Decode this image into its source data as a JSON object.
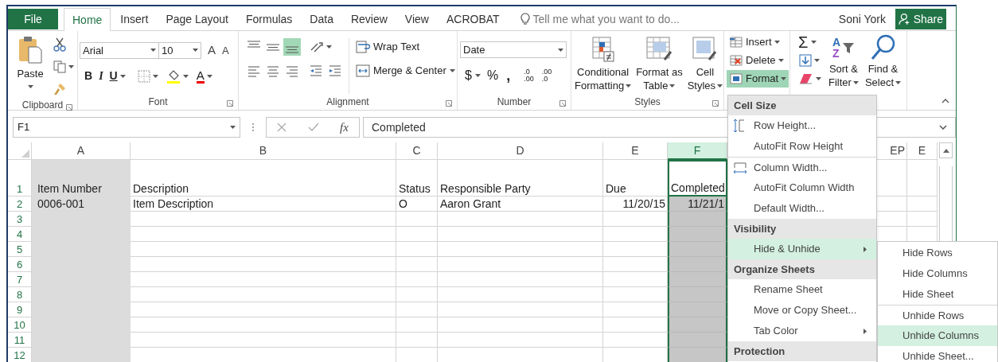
{
  "tabs": [
    {
      "label": "File",
      "kind": "file",
      "selected": false
    },
    {
      "label": "Home",
      "kind": "tab",
      "selected": true
    },
    {
      "label": "Insert",
      "kind": "tab",
      "selected": false
    },
    {
      "label": "Page Layout",
      "kind": "tab",
      "selected": false
    },
    {
      "label": "Formulas",
      "kind": "tab",
      "selected": false
    },
    {
      "label": "Data",
      "kind": "tab",
      "selected": false
    },
    {
      "label": "Review",
      "kind": "tab",
      "selected": false
    },
    {
      "label": "View",
      "kind": "tab",
      "selected": false
    },
    {
      "label": "ACROBAT",
      "kind": "tab",
      "selected": false
    }
  ],
  "tell_me": {
    "placeholder": "Tell me what you want to do..."
  },
  "user": "Soni York",
  "share_button": "Share",
  "ribbon": {
    "clipboard": {
      "paste": "Paste",
      "label": "Clipboard"
    },
    "font": {
      "font_name": "Arial",
      "font_size": "10",
      "grow": "A",
      "shrink": "A",
      "bold": "B",
      "italic": "I",
      "underline": "U",
      "font_color": "A",
      "label": "Font"
    },
    "alignment": {
      "vertical": [
        {
          "selected": false
        },
        {
          "selected": false
        },
        {
          "selected": true
        }
      ],
      "wrap_text": "Wrap Text",
      "merge_center": "Merge & Center",
      "label": "Alignment"
    },
    "number": {
      "format": "Date",
      "currency": "$",
      "percent": "%",
      "comma": ",",
      "decimals": [
        {
          "top": ".0",
          "bottom": ".00"
        },
        {
          "top": ".00",
          "bottom": ".0"
        }
      ],
      "label": "Number"
    },
    "styles": {
      "buttons": [
        {
          "kind": "conditional",
          "lines": [
            "Conditional",
            "Formatting"
          ]
        },
        {
          "kind": "table",
          "lines": [
            "Format as",
            "Table"
          ]
        },
        {
          "kind": "cell",
          "lines": [
            "Cell",
            "Styles"
          ]
        }
      ],
      "label": "Styles"
    },
    "cells": {
      "buttons": [
        {
          "kind": "insert",
          "label": "Insert",
          "expanded": false
        },
        {
          "kind": "delete",
          "label": "Delete",
          "expanded": false
        },
        {
          "kind": "format",
          "label": "Format",
          "expanded": true
        }
      ]
    },
    "editing": {
      "autosum": "Σ",
      "sort_letters": [
        "A",
        "Z"
      ],
      "sort": [
        "Sort &",
        "Filter"
      ],
      "find": [
        "Find &",
        "Select"
      ]
    }
  },
  "name_box": "F1",
  "fx": "fx",
  "formula": "Completed",
  "columns": [
    {
      "label": "A",
      "selected": false
    },
    {
      "label": "B",
      "selected": false
    },
    {
      "label": "C",
      "selected": false
    },
    {
      "label": "D",
      "selected": false
    },
    {
      "label": "E",
      "selected": false
    },
    {
      "label": "F",
      "selected": true
    },
    {
      "label": "EP",
      "selected": false
    },
    {
      "label": "E",
      "selected": false
    }
  ],
  "row_numbers": [
    "1",
    "2",
    "3",
    "4",
    "5",
    "6",
    "7",
    "8",
    "9",
    "10",
    "11",
    "12"
  ],
  "rows": [
    {
      "cells": [
        "Item Number",
        "Description",
        "Status",
        "Responsible Party",
        "Due",
        "Completed"
      ]
    },
    {
      "cells": [
        "0006-001",
        "Item Description",
        "O",
        "Aaron Grant",
        "11/20/15",
        "11/21/1"
      ]
    }
  ],
  "format_menu": {
    "sections": [
      {
        "heading": "Cell Size",
        "items": [
          {
            "label": "Row Height...",
            "kind": "row_height",
            "selected": false,
            "separator_before": false
          },
          {
            "label": "AutoFit Row Height",
            "kind": "plain",
            "selected": false,
            "separator_before": false
          },
          {
            "label": "Column Width...",
            "kind": "column_width",
            "selected": false,
            "separator_before": true
          },
          {
            "label": "AutoFit Column Width",
            "kind": "plain",
            "selected": false,
            "separator_before": false
          },
          {
            "label": "Default Width...",
            "kind": "plain",
            "selected": false,
            "separator_before": false
          }
        ]
      },
      {
        "heading": "Visibility",
        "items": [
          {
            "label": "Hide & Unhide",
            "kind": "submenu",
            "selected": true,
            "separator_before": false
          }
        ]
      },
      {
        "heading": "Organize Sheets",
        "items": [
          {
            "label": "Rename Sheet",
            "kind": "plain",
            "selected": false,
            "separator_before": false
          },
          {
            "label": "Move or Copy Sheet...",
            "kind": "plain",
            "selected": false,
            "separator_before": false
          },
          {
            "label": "Tab Color",
            "kind": "submenu",
            "selected": false,
            "separator_before": false
          }
        ]
      },
      {
        "heading": "Protection"
      }
    ]
  },
  "submenu": {
    "items": [
      {
        "label": "Hide Rows",
        "selected": false,
        "separator_before": false
      },
      {
        "label": "Hide Columns",
        "selected": false,
        "separator_before": false
      },
      {
        "label": "Hide Sheet",
        "selected": false,
        "separator_before": false
      },
      {
        "label": "Unhide Rows",
        "selected": false,
        "separator_before": true
      },
      {
        "label": "Unhide Columns",
        "selected": true,
        "separator_before": false
      },
      {
        "label": "Unhide Sheet...",
        "selected": false,
        "separator_before": false
      }
    ]
  }
}
